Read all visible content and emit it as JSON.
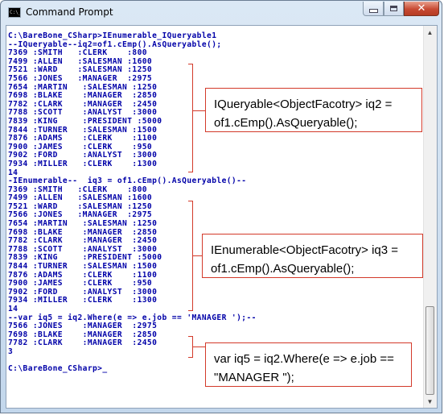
{
  "window": {
    "title": "Command Prompt",
    "app_icon_text": "C:\\_"
  },
  "controls": {
    "minimize_icon": "minimize-icon",
    "maximize_icon": "maximize-icon",
    "close_icon": "close-icon",
    "close_glyph": "✕"
  },
  "console": {
    "lines": [
      "C:\\BareBone_CSharp>IEnumerable_IQueryable1",
      "--IQueryable--iq2=of1.cEmp().AsQueryable();",
      "7369 :SMITH   :CLERK    :800",
      "7499 :ALLEN   :SALESMAN :1600",
      "7521 :WARD    :SALESMAN :1250",
      "7566 :JONES   :MANAGER  :2975",
      "7654 :MARTIN   :SALESMAN :1250",
      "7698 :BLAKE    :MANAGER  :2850",
      "7782 :CLARK    :MANAGER  :2450",
      "7788 :SCOTT    :ANALYST  :3000",
      "7839 :KING     :PRESIDENT :5000",
      "7844 :TURNER   :SALESMAN :1500",
      "7876 :ADAMS    :CLERK    :1100",
      "7900 :JAMES    :CLERK    :950",
      "7902 :FORD     :ANALYST  :3000",
      "7934 :MILLER   :CLERK    :1300",
      "14",
      "-IEnumerable--  iq3 = of1.cEmp().AsQueryable()--",
      "7369 :SMITH   :CLERK    :800",
      "7499 :ALLEN   :SALESMAN :1600",
      "7521 :WARD    :SALESMAN :1250",
      "7566 :JONES   :MANAGER  :2975",
      "7654 :MARTIN   :SALESMAN :1250",
      "7698 :BLAKE    :MANAGER  :2850",
      "7782 :CLARK    :MANAGER  :2450",
      "7788 :SCOTT    :ANALYST  :3000",
      "7839 :KING     :PRESIDENT :5000",
      "7844 :TURNER   :SALESMAN :1500",
      "7876 :ADAMS    :CLERK    :1100",
      "7900 :JAMES    :CLERK    :950",
      "7902 :FORD     :ANALYST  :3000",
      "7934 :MILLER   :CLERK    :1300",
      "14",
      "--var iq5 = iq2.Where(e => e.job == 'MANAGER ');--",
      "7566 :JONES    :MANAGER  :2975",
      "7698 :BLAKE    :MANAGER  :2850",
      "7782 :CLARK    :MANAGER  :2450",
      "3",
      "",
      "C:\\BareBone_CSharp>_"
    ]
  },
  "annotations": [
    {
      "text": "IQueryable<ObjectFacotry> iq2 = of1.cEmp().AsQueryable();"
    },
    {
      "text": "IEnumerable<ObjectFacotry> iq3 = of1.cEmp().AsQueryable();"
    },
    {
      "text": "var iq5 = iq2.Where(e => e.job == \"MANAGER \");"
    }
  ],
  "colors": {
    "console_text": "#0000a8",
    "console_background": "#ffffff",
    "annotation_border": "#d33a2a",
    "close_button": "#c74a33"
  }
}
